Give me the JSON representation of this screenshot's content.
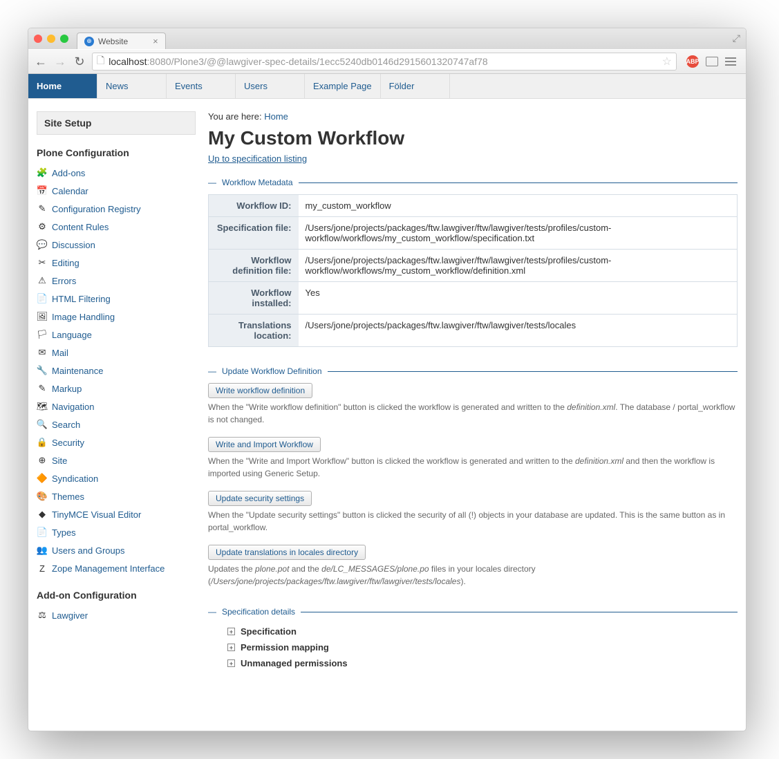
{
  "browser": {
    "tab_title": "Website",
    "url_prefix": "localhost",
    "url_port_path": ":8080/Plone3/@@lawgiver-spec-details/1ecc5240db0146d2915601320747af78"
  },
  "global_tabs": [
    {
      "label": "Home",
      "active": true
    },
    {
      "label": "News",
      "active": false
    },
    {
      "label": "Events",
      "active": false
    },
    {
      "label": "Users",
      "active": false
    },
    {
      "label": "Example Page",
      "active": false
    },
    {
      "label": "Földer",
      "active": false
    }
  ],
  "sidebar": {
    "header": "Site Setup",
    "section1_title": "Plone Configuration",
    "items": [
      {
        "icon": "🧩",
        "label": "Add-ons"
      },
      {
        "icon": "📅",
        "label": "Calendar"
      },
      {
        "icon": "✎",
        "label": "Configuration Registry"
      },
      {
        "icon": "⚙",
        "label": "Content Rules"
      },
      {
        "icon": "💬",
        "label": "Discussion"
      },
      {
        "icon": "✂",
        "label": "Editing"
      },
      {
        "icon": "⚠",
        "label": "Errors"
      },
      {
        "icon": "📄",
        "label": "HTML Filtering"
      },
      {
        "icon": "🖼",
        "label": "Image Handling"
      },
      {
        "icon": "🏳",
        "label": "Language"
      },
      {
        "icon": "✉",
        "label": "Mail"
      },
      {
        "icon": "🔧",
        "label": "Maintenance"
      },
      {
        "icon": "✎",
        "label": "Markup"
      },
      {
        "icon": "🗺",
        "label": "Navigation"
      },
      {
        "icon": "🔍",
        "label": "Search"
      },
      {
        "icon": "🔒",
        "label": "Security"
      },
      {
        "icon": "⊕",
        "label": "Site"
      },
      {
        "icon": "🔶",
        "label": "Syndication"
      },
      {
        "icon": "🎨",
        "label": "Themes"
      },
      {
        "icon": "◆",
        "label": "TinyMCE Visual Editor"
      },
      {
        "icon": "📄",
        "label": "Types"
      },
      {
        "icon": "👥",
        "label": "Users and Groups"
      },
      {
        "icon": "Z",
        "label": "Zope Management Interface"
      }
    ],
    "section2_title": "Add-on Configuration",
    "addon_items": [
      {
        "icon": "⚖",
        "label": "Lawgiver"
      }
    ]
  },
  "breadcrumb": {
    "prefix": "You are here:",
    "home": "Home"
  },
  "page_title": "My Custom Workflow",
  "uplink": "Up to specification listing",
  "metadata": {
    "legend": "Workflow Metadata",
    "rows": [
      {
        "key": "Workflow ID:",
        "value": "my_custom_workflow"
      },
      {
        "key": "Specification file:",
        "value": "/Users/jone/projects/packages/ftw.lawgiver/ftw/lawgiver/tests/profiles/custom-workflow/workflows/my_custom_workflow/specification.txt"
      },
      {
        "key": "Workflow definition file:",
        "value": "/Users/jone/projects/packages/ftw.lawgiver/ftw/lawgiver/tests/profiles/custom-workflow/workflows/my_custom_workflow/definition.xml"
      },
      {
        "key": "Workflow installed:",
        "value": "Yes"
      },
      {
        "key": "Translations location:",
        "value": "/Users/jone/projects/packages/ftw.lawgiver/ftw/lawgiver/tests/locales"
      }
    ]
  },
  "update": {
    "legend": "Update Workflow Definition",
    "actions": [
      {
        "button": "Write workflow definition",
        "desc_pre": "When the \"Write workflow definition\" button is clicked the workflow is generated and written to the ",
        "desc_em": "definition.xml",
        "desc_post": ". The database / portal_workflow is not changed."
      },
      {
        "button": "Write and Import Workflow",
        "desc_pre": "When the \"Write and Import Workflow\" button is clicked the workflow is generated and written to the ",
        "desc_em": "definition.xml",
        "desc_post": " and then the workflow is imported using Generic Setup."
      },
      {
        "button": "Update security settings",
        "desc_pre": "When the \"Update security settings\" button is clicked the security of all (!) objects in your database are updated. This is the same button as in portal_workflow.",
        "desc_em": "",
        "desc_post": ""
      },
      {
        "button": "Update translations in locales directory",
        "desc_pre": "Updates the ",
        "desc_em": "plone.pot",
        "desc_mid": " and the ",
        "desc_em2": "de/LC_MESSAGES/plone.po",
        "desc_post2": " files in your locales directory (",
        "desc_em3": "/Users/jone/projects/packages/ftw.lawgiver/ftw/lawgiver/tests/locales",
        "desc_post3": ")."
      }
    ]
  },
  "spec": {
    "legend": "Specification details",
    "items": [
      "Specification",
      "Permission mapping",
      "Unmanaged permissions"
    ]
  }
}
